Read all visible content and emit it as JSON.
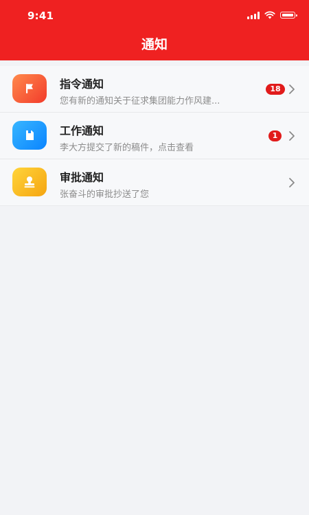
{
  "status_bar": {
    "time": "9:41"
  },
  "header": {
    "title": "通知"
  },
  "colors": {
    "header_bg": "#ef2121",
    "badge": "#e11b1b",
    "icon_orange": "#ff5a3c",
    "icon_blue": "#1890ff",
    "icon_yellow": "#fbbf1a"
  },
  "notifications": [
    {
      "icon": "flag-icon",
      "title": "指令通知",
      "desc": "您有新的通知关于征求集团能力作风建...",
      "badge": "18"
    },
    {
      "icon": "document-icon",
      "title": "工作通知",
      "desc": "李大方提交了新的稿件，点击查看",
      "badge": "1"
    },
    {
      "icon": "stamp-icon",
      "title": "审批通知",
      "desc": "张奋斗的审批抄送了您",
      "badge": ""
    }
  ]
}
